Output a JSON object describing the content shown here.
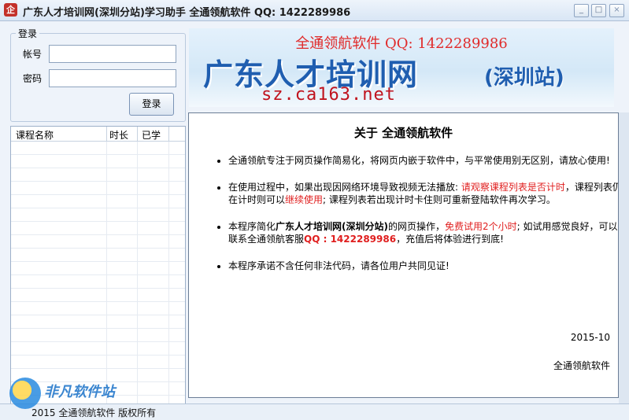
{
  "window": {
    "icon_glyph": "企",
    "title": "广东人才培训网(深圳分站)学习助手 全通领航软件 QQ: 1422289986",
    "min_glyph": "_",
    "max_glyph": "□",
    "close_glyph": "×"
  },
  "login": {
    "legend": "登录",
    "account_label": "帐号",
    "account_value": "",
    "password_label": "密码",
    "password_value": "",
    "login_button": "登录"
  },
  "course_table": {
    "columns": [
      "课程名称",
      "时长",
      "已学"
    ],
    "rows": []
  },
  "banner": {
    "top_text": "全通领航软件 QQ: 1422289986",
    "main_text": "广东人才培训网",
    "sub_text": "(深圳站)",
    "url": "sz.ca163.net"
  },
  "about": {
    "title": "关于 全通领航软件",
    "item1": "全通领航专注于网页操作简易化，将网页内嵌于软件中，与平常使用别无区别，请放心使用!",
    "item2": {
      "p1": "在使用过程中，如果出现因网络环境导致视频无法播放: ",
      "p2": "请观察课程列表是否计时",
      "p3": "，课程列表仍在计时则可以",
      "p4": "继续使用",
      "p5": "; 课程列表若出现计时卡住则可重新登陆软件再次学习。"
    },
    "item3": {
      "p1": "本程序简化",
      "p2": "广东人才培训网(深圳分站)",
      "p3": "的网页操作，",
      "p4": "免费试用2个小时",
      "p5": "; 如试用感觉良好，可以联系全通领航客服",
      "p6": "QQ : 1422289986",
      "p7": "，充值后将体验进行到底!"
    },
    "item4": "本程序承诺不含任何非法代码，请各位用户共同见证!",
    "date": "2015-10",
    "signature": "全通领航软件"
  },
  "status": {
    "text": "2015 全通领航软件 版权所有"
  },
  "watermark": {
    "text": "非凡软件站"
  }
}
